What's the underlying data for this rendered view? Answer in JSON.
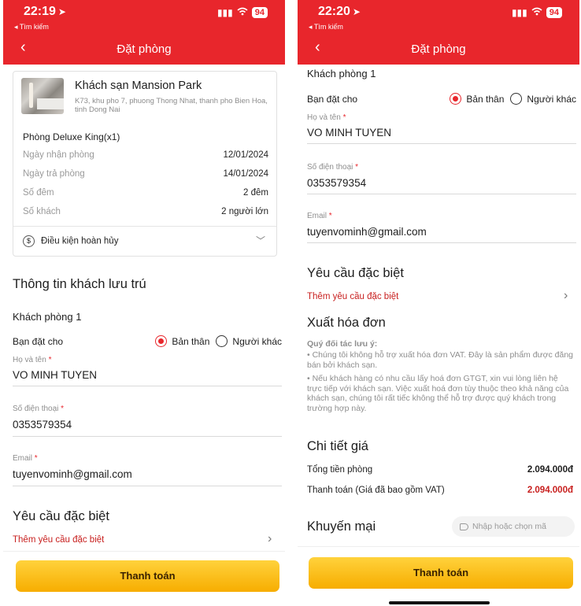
{
  "status_bar_left": {
    "time": "22:19",
    "back_app": "◂ Tìm kiếm",
    "battery": "94"
  },
  "status_bar_right": {
    "time": "22:20",
    "back_app": "◂ Tìm kiếm",
    "battery": "94"
  },
  "colors": {
    "brand_red": "#e8262c",
    "button_yellow": "#ffc61a"
  },
  "icons": [
    "location-arrow-icon",
    "signal-icon",
    "wifi-icon",
    "battery-icon",
    "back-chevron-icon",
    "refund-coin-icon",
    "chevron-down-icon",
    "chevron-right-icon",
    "tag-icon",
    "radio-selected-icon",
    "radio-unselected-icon"
  ],
  "header": {
    "title": "Đặt phòng",
    "back": "‹"
  },
  "hotel": {
    "name": "Khách sạn Mansion Park",
    "address": "K73, khu pho 7, phuong Thong Nhat, thanh pho Bien Hoa, tinh Dong Nai",
    "room_type": "Phòng Deluxe King(x1)",
    "rows": [
      {
        "label": "Ngày nhận phòng",
        "value": "12/01/2024"
      },
      {
        "label": "Ngày trả phòng",
        "value": "14/01/2024"
      },
      {
        "label": "Số đêm",
        "value": "2 đêm"
      },
      {
        "label": "Số khách",
        "value": "2 người lớn"
      }
    ],
    "cancel_policy": "Điều kiện hoàn hủy",
    "cancel_icon": "$"
  },
  "guest": {
    "section_title": "Thông tin khách lưu trú",
    "room_label": "Khách phòng 1",
    "booking_for_label": "Bạn đặt cho",
    "option_self": "Bản thân",
    "option_other": "Người khác",
    "name_label": "Họ và tên",
    "name_value": "VO MINH TUYEN",
    "phone_label": "Số điện thoại",
    "phone_value": "0353579354",
    "email_label": "Email",
    "email_value": "tuyenvominh@gmail.com",
    "required_mark": "*"
  },
  "special_request": {
    "title": "Yêu cầu đặc biệt",
    "add_link": "Thêm yêu cầu đặc biệt"
  },
  "invoice": {
    "title": "Xuất hóa đơn",
    "note_title": "Quý đối tác lưu ý:",
    "note_1": "• Chúng tôi không hỗ trợ xuất hóa đơn VAT. Đây là sản phẩm được đăng bán bởi khách sạn.",
    "note_2": "• Nếu khách hàng có nhu cầu lấy hoá đơn GTGT, xin vui lòng liên hệ trực tiếp với khách sạn. Việc xuất hoá đơn tùy thuộc theo khả năng của khách sạn, chúng tôi rất tiếc không thể hỗ trợ được quý khách trong trường hợp này."
  },
  "price": {
    "title": "Chi tiết giá",
    "room_total_label": "Tổng tiền phòng",
    "room_total_value": "2.094.000đ",
    "pay_label": "Thanh toán (Giá đã bao gồm VAT)",
    "pay_value": "2.094.000đ"
  },
  "promo": {
    "title": "Khuyến mại",
    "placeholder": "Nhập hoặc chọn mã"
  },
  "pay_button": "Thanh toán",
  "glyphs": {
    "arrow": "➤",
    "chevron_right": "›",
    "chevron_down": "﹀",
    "signal": "▮▮▮",
    "wifi": "◠"
  }
}
